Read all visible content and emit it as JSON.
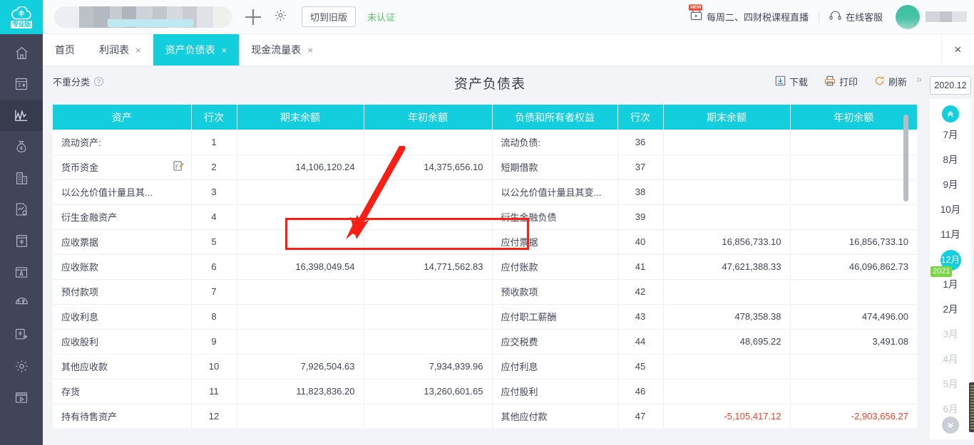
{
  "brand": {
    "pro_label": "专业版",
    "accent": "#13cfdd",
    "rail_bg": "#424459"
  },
  "header": {
    "switch_old_label": "切到旧版",
    "uncertified_label": "未认证",
    "new_badge": "NEW",
    "live_course_label": "每周二、四财税课程直播",
    "online_service_label": "在线客服"
  },
  "rail": {
    "items": [
      {
        "name": "home",
        "label": "首页",
        "active": false
      },
      {
        "name": "bookkeeping",
        "label": "记账",
        "active": false
      },
      {
        "name": "reports",
        "label": "报表",
        "active": true
      },
      {
        "name": "funds",
        "label": "资金",
        "active": false
      },
      {
        "name": "assets",
        "label": "资产",
        "active": false
      },
      {
        "name": "analysis",
        "label": "分析",
        "active": false
      },
      {
        "name": "invoice",
        "label": "发票",
        "active": false
      },
      {
        "name": "archive",
        "label": "档案",
        "active": false
      },
      {
        "name": "tax",
        "label": "税务",
        "active": false
      },
      {
        "name": "settlement",
        "label": "结转",
        "active": false
      },
      {
        "name": "settings",
        "label": "设置",
        "active": false
      },
      {
        "name": "video",
        "label": "视频",
        "active": false
      }
    ]
  },
  "tabs": {
    "items": [
      {
        "label": "首页",
        "closable": false,
        "active": false
      },
      {
        "label": "利润表",
        "closable": true,
        "active": false
      },
      {
        "label": "资产负债表",
        "closable": true,
        "active": true
      },
      {
        "label": "现金流量表",
        "closable": true,
        "active": false
      }
    ],
    "close_all_icon": "×"
  },
  "sheet": {
    "no_dup_label": "不重分类",
    "help_icon": "?",
    "title": "资产负债表",
    "actions": [
      {
        "name": "download",
        "label": "下载"
      },
      {
        "name": "print",
        "label": "打印"
      },
      {
        "name": "refresh",
        "label": "刷新"
      }
    ]
  },
  "table": {
    "headers_left": [
      "资产",
      "行次",
      "期末余额",
      "年初余额"
    ],
    "headers_right": [
      "负债和所有者权益",
      "行次",
      "期末余额",
      "年初余额"
    ],
    "rows": [
      {
        "l_name": "流动资产:",
        "l_group": true,
        "l_no": "1",
        "l_end": "",
        "l_begin": "",
        "r_name": "流动负债:",
        "r_group": true,
        "r_no": "36",
        "r_end": "",
        "r_begin": ""
      },
      {
        "l_name": "货币资金",
        "l_group": false,
        "l_fx": true,
        "l_no": "2",
        "l_end": "14,106,120.24",
        "l_begin": "14,375,656.10",
        "r_name": "短期借款",
        "r_group": false,
        "r_no": "37",
        "r_end": "",
        "r_begin": ""
      },
      {
        "l_name": "以公允价值计量且其...",
        "l_group": false,
        "l_no": "3",
        "l_end": "",
        "l_begin": "",
        "r_name": "以公允价值计量且其变...",
        "r_group": false,
        "r_no": "38",
        "r_end": "",
        "r_begin": ""
      },
      {
        "l_name": "衍生金融资产",
        "l_group": false,
        "l_no": "4",
        "l_end": "",
        "l_begin": "",
        "r_name": "衍生金融负债",
        "r_group": false,
        "r_no": "39",
        "r_end": "",
        "r_begin": ""
      },
      {
        "l_name": "应收票据",
        "l_group": false,
        "l_no": "5",
        "l_end": "",
        "l_begin": "",
        "r_name": "应付票据",
        "r_group": false,
        "r_no": "40",
        "r_end": "16,856,733.10",
        "r_begin": "16,856,733.10"
      },
      {
        "l_name": "应收账款",
        "l_group": false,
        "l_no": "6",
        "l_end": "16,398,049.54",
        "l_begin": "14,771,562.83",
        "r_name": "应付账款",
        "r_group": false,
        "r_no": "41",
        "r_end": "47,621,388.33",
        "r_begin": "46,096,862.73"
      },
      {
        "l_name": "预付款项",
        "l_group": false,
        "l_no": "7",
        "l_end": "",
        "l_begin": "",
        "r_name": "预收款项",
        "r_group": false,
        "r_no": "42",
        "r_end": "",
        "r_begin": ""
      },
      {
        "l_name": "应收利息",
        "l_group": false,
        "l_no": "8",
        "l_end": "",
        "l_begin": "",
        "r_name": "应付职工薪酬",
        "r_group": false,
        "r_no": "43",
        "r_end": "478,358.38",
        "r_begin": "474,496.00"
      },
      {
        "l_name": "应收股利",
        "l_group": false,
        "l_no": "9",
        "l_end": "",
        "l_begin": "",
        "r_name": "应交税费",
        "r_group": false,
        "r_no": "44",
        "r_end": "48,695.22",
        "r_begin": "3,491.08"
      },
      {
        "l_name": "其他应收款",
        "l_group": false,
        "l_no": "10",
        "l_end": "7,926,504.63",
        "l_begin": "7,934,939.96",
        "r_name": "应付利息",
        "r_group": false,
        "r_no": "45",
        "r_end": "",
        "r_begin": ""
      },
      {
        "l_name": "存货",
        "l_group": false,
        "l_no": "11",
        "l_end": "11,823,836.20",
        "l_begin": "13,260,601.65",
        "r_name": "应付股利",
        "r_group": false,
        "r_no": "46",
        "r_end": "",
        "r_begin": ""
      },
      {
        "l_name": "持有待售资产",
        "l_group": false,
        "l_no": "12",
        "l_end": "",
        "l_begin": "",
        "r_name": "其他应付款",
        "r_group": false,
        "r_no": "47",
        "r_end": "-5,105,417.12",
        "r_end_neg": true,
        "r_begin": "-2,903,656.27",
        "r_begin_neg": true
      }
    ]
  },
  "period": {
    "selected_value": "2020.12",
    "up_icon": "«",
    "down_icon": "»",
    "year_badge": "2021",
    "months": [
      {
        "label": "7月",
        "state": "normal"
      },
      {
        "label": "8月",
        "state": "normal"
      },
      {
        "label": "9月",
        "state": "normal"
      },
      {
        "label": "10月",
        "state": "normal"
      },
      {
        "label": "11月",
        "state": "normal"
      },
      {
        "label": "12月",
        "state": "selected"
      },
      {
        "label": "1月",
        "state": "normal",
        "year_start": true
      },
      {
        "label": "2月",
        "state": "normal"
      },
      {
        "label": "3月",
        "state": "disabled"
      },
      {
        "label": "4月",
        "state": "disabled"
      },
      {
        "label": "5月",
        "state": "disabled"
      },
      {
        "label": "6月",
        "state": "disabled"
      }
    ]
  },
  "annotation": {
    "box_color": "#fa1e14",
    "arrow_color": "#fa1e14"
  }
}
